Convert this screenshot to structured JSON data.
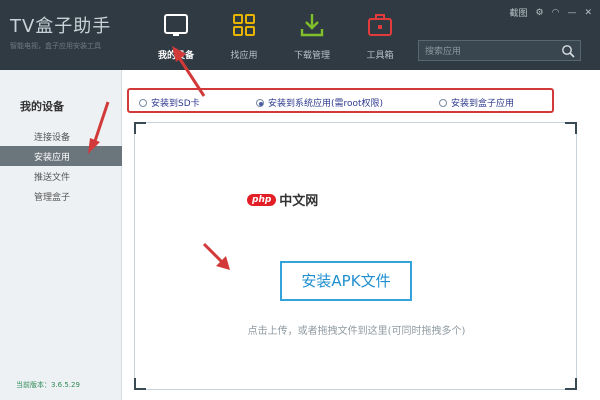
{
  "app": {
    "title": "TV盒子助手",
    "subtitle": "智能电视，盒子应用安装工具"
  },
  "nav": [
    {
      "label": "我的设备",
      "icon": "tablet-icon",
      "active": true
    },
    {
      "label": "找应用",
      "icon": "grid-icon",
      "active": false
    },
    {
      "label": "下载管理",
      "icon": "download-icon",
      "active": false
    },
    {
      "label": "工具箱",
      "icon": "toolbox-icon",
      "active": false
    }
  ],
  "window_controls": {
    "screenshot_label": "截图"
  },
  "search": {
    "placeholder": "搜索应用"
  },
  "sidebar": {
    "heading": "我的设备",
    "items": [
      {
        "label": "连接设备",
        "active": false
      },
      {
        "label": "安装应用",
        "active": true
      },
      {
        "label": "推送文件",
        "active": false
      },
      {
        "label": "管理盒子",
        "active": false
      }
    ],
    "version": "当前版本：3.6.5.29"
  },
  "install_options": [
    {
      "label": "安装到SD卡",
      "selected": false
    },
    {
      "label": "安装到系统应用(需root权限)",
      "selected": true
    },
    {
      "label": "安装到盒子应用",
      "selected": false
    }
  ],
  "main": {
    "install_button": "安装APK文件",
    "hint": "点击上传，或者拖拽文件到这里(可同时拖拽多个)"
  },
  "watermark": {
    "badge": "php",
    "text": "中文网"
  },
  "colors": {
    "topbar": "#2f3a42",
    "sidebar": "#eef1f3",
    "active_item": "#6b757c",
    "accent": "#33a3dc",
    "annotation_red": "#d23a3a"
  }
}
